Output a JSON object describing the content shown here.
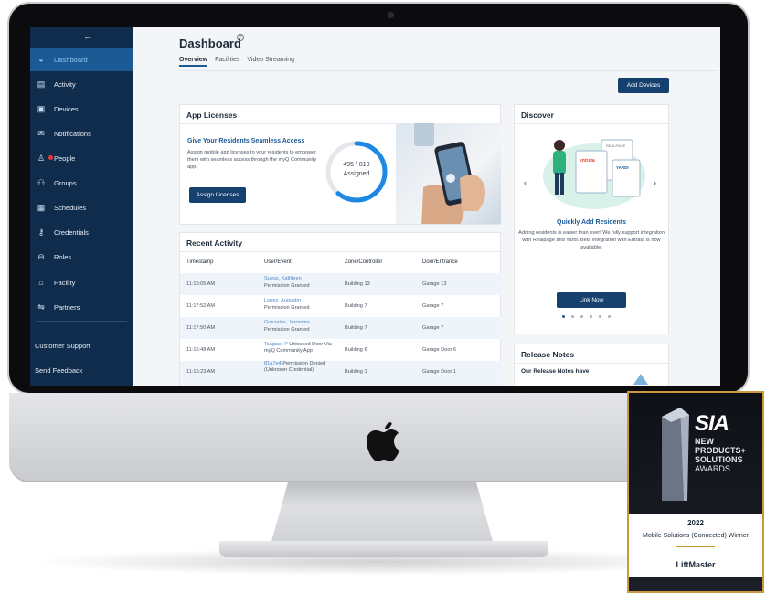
{
  "sidebar": {
    "back_icon": "←",
    "items": [
      {
        "label": "Dashboard",
        "icon": "dashboard-icon",
        "active": true
      },
      {
        "label": "Activity",
        "icon": "activity-icon"
      },
      {
        "label": "Devices",
        "icon": "devices-icon"
      },
      {
        "label": "Notifications",
        "icon": "notifications-icon"
      },
      {
        "label": "People",
        "icon": "people-icon",
        "badge": true
      },
      {
        "label": "Groups",
        "icon": "groups-icon"
      },
      {
        "label": "Schedules",
        "icon": "schedules-icon"
      },
      {
        "label": "Credentials",
        "icon": "credentials-icon"
      },
      {
        "label": "Roles",
        "icon": "roles-icon"
      },
      {
        "label": "Facility",
        "icon": "facility-icon"
      },
      {
        "label": "Partners",
        "icon": "partners-icon"
      }
    ],
    "footer": [
      "Customer Support",
      "Send Feedback"
    ],
    "accent": "#0f2c4c",
    "active_color": "#1b5a95"
  },
  "header": {
    "title": "Dashboard",
    "help_icon": "?",
    "tabs": [
      "Overview",
      "Facilities",
      "Video Streaming"
    ],
    "active_tab": "Overview",
    "add_devices_label": "Add Devices"
  },
  "licenses": {
    "title": "App Licenses",
    "headline": "Give Your Residents Seamless Access",
    "description": "Assign mobile app licenses to your residents to empower them with seamless access through the myQ Community app.",
    "assigned_count": "495 / 810",
    "assigned_label": "Assigned",
    "assigned_fraction": 0.611,
    "button_label": "Assign Licenses"
  },
  "activity": {
    "title": "Recent Activity",
    "columns": [
      "Timestamp",
      "User/Event",
      "Zone/Controller",
      "Door/Entrance"
    ],
    "rows": [
      {
        "time": "11:19:05 AM",
        "user": "Suess, Kathleen",
        "event": "Permission Granted",
        "zone": "Building 13",
        "door": "Garage 13"
      },
      {
        "time": "11:17:52 AM",
        "user": "Lopez, Augustin",
        "event": "Permission Granted",
        "zone": "Building 7",
        "door": "Garage 7"
      },
      {
        "time": "11:17:50 AM",
        "user": "Gonzales, Jeronimo",
        "event": "Permission Granted",
        "zone": "Building 7",
        "door": "Garage 7"
      },
      {
        "time": "11:16:48 AM",
        "user": "Tsagias, P",
        "event": "Unlocked Door Via myQ Community App",
        "zone": "Building 6",
        "door": "Garage Door 6"
      },
      {
        "time": "11:15:23 AM",
        "user": "81a7e4",
        "event": "Permission Denied (Unknown Credential)",
        "zone": "Building 1",
        "door": "Garage Door 1"
      }
    ]
  },
  "discover": {
    "title": "Discover",
    "headline": "Quickly Add Residents",
    "description": "Adding residents is easier than ever! We fully support integration with Realpage and Yardi. Beta integration with Entrata is now available.",
    "button_label": "Link Now",
    "prev_icon": "‹",
    "next_icon": "›",
    "slide_count": 6,
    "active_slide": 0,
    "logos": [
      "entrata",
      "REALPAGE",
      "YARDI"
    ]
  },
  "release_notes": {
    "title": "Release Notes",
    "subtitle": "Our Release Notes have"
  },
  "award": {
    "brand": "SIA",
    "line1": "NEW",
    "line2": "PRODUCTS+",
    "line3": "SOLUTIONS",
    "line4": "AWARDS",
    "year": "2022",
    "category": "Mobile Solutions (Connected) Winner",
    "winner": "LiftMaster"
  }
}
